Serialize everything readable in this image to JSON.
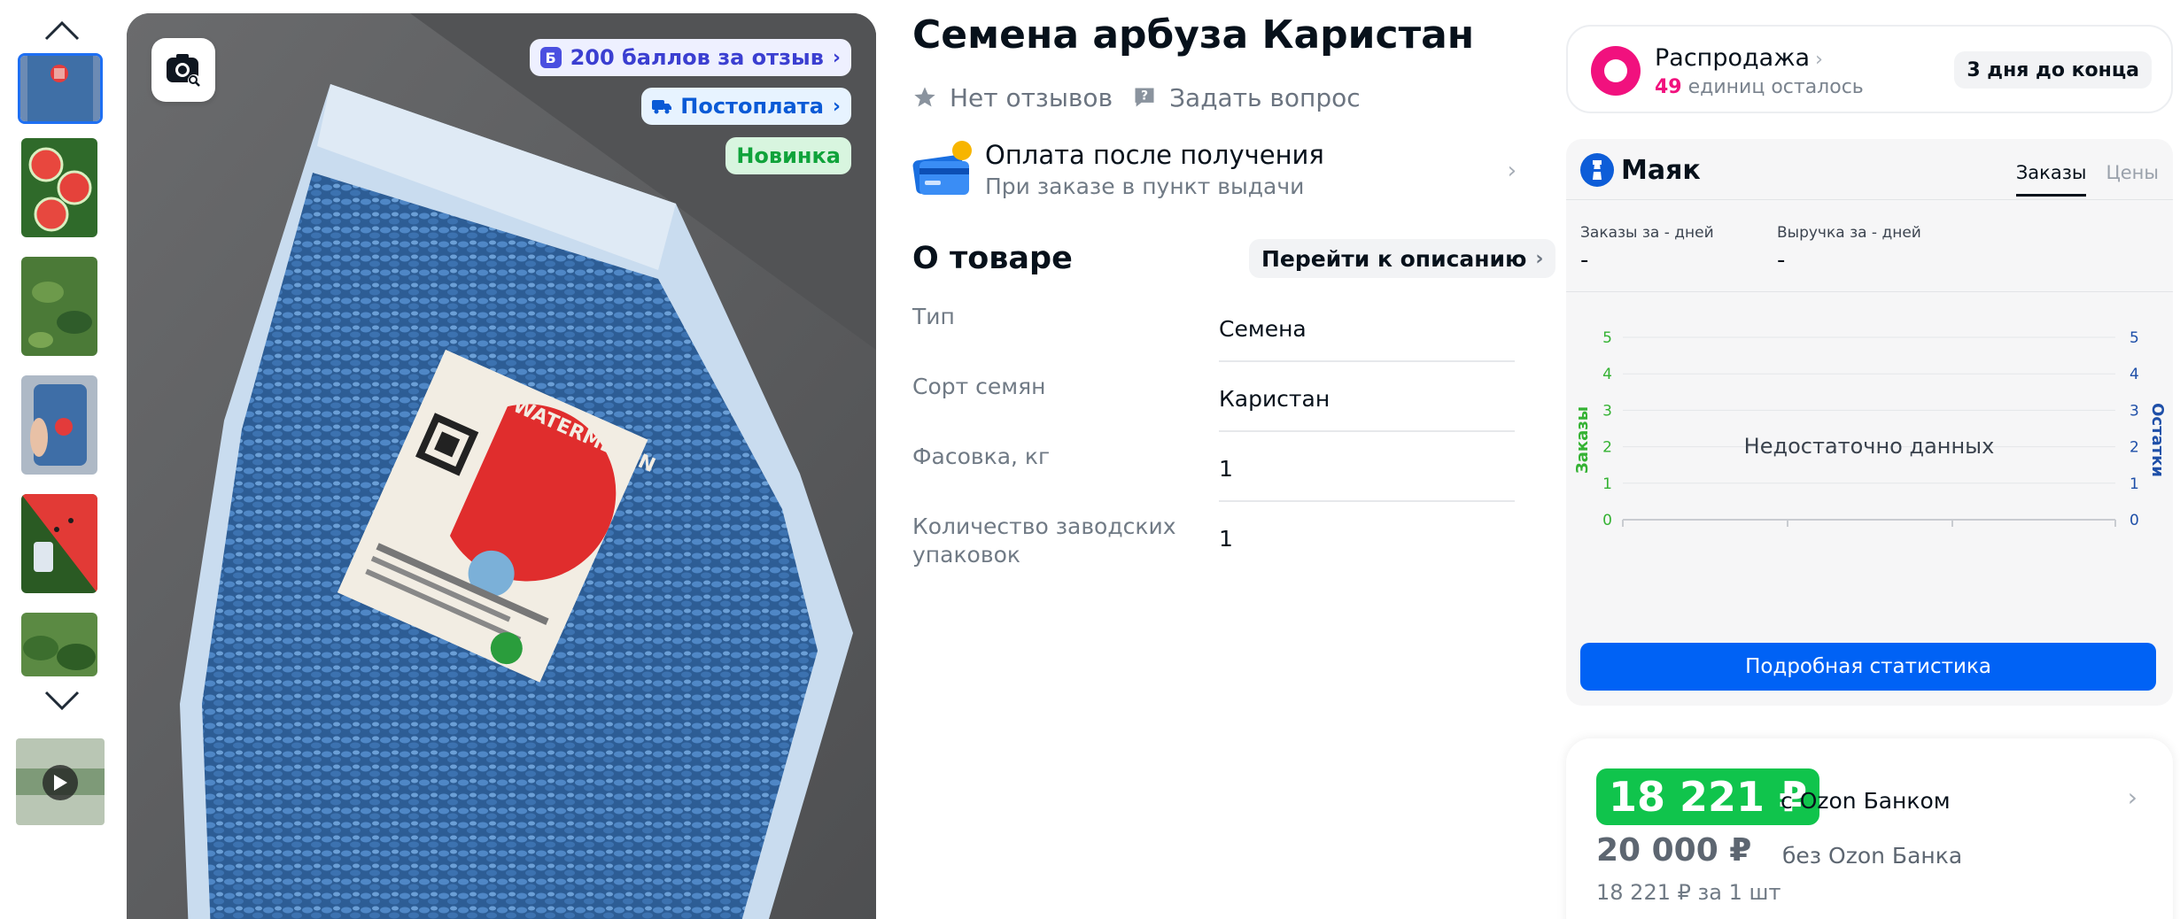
{
  "gallery": {
    "thumbnails": [
      "thumb-1",
      "thumb-2",
      "thumb-3",
      "thumb-4",
      "thumb-5",
      "thumb-6"
    ],
    "video_thumbnail": "video-thumb"
  },
  "main_image": {
    "badges": {
      "points": "200 баллов за отзыв",
      "points_icon": "Б",
      "postpay": "Постоплата",
      "new": "Новинка"
    },
    "package_label_text": "WATERMELON"
  },
  "product": {
    "title": "Семена арбуза Каристан",
    "reviews": "Нет отзывов",
    "ask_question": "Задать вопрос",
    "payment": {
      "title": "Оплата после получения",
      "subtitle": "При заказе в пункт выдачи"
    },
    "about": {
      "title": "О товаре",
      "goto_description": "Перейти к описанию"
    },
    "specs": [
      {
        "key": "Тип",
        "value": "Семена"
      },
      {
        "key": "Сорт семян",
        "value": "Каристан"
      },
      {
        "key": "Фасовка, кг",
        "value": "1"
      },
      {
        "key": "Количество заводских упаковок",
        "value": "1"
      }
    ]
  },
  "sale": {
    "title": "Распродажа",
    "count": "49",
    "remaining": "единиц осталось",
    "timer": "3 дня до конца"
  },
  "mayak": {
    "name": "Маяк",
    "tabs": [
      "Заказы",
      "Цены"
    ],
    "active_tab": "Заказы",
    "stats": [
      {
        "label": "Заказы за - дней",
        "value": "-"
      },
      {
        "label": "Выручка за - дней",
        "value": "-"
      }
    ],
    "chart_message": "Недостаточно данных",
    "left_axis_label": "Заказы",
    "right_axis_label": "Остатки",
    "ticks": [
      "0",
      "1",
      "2",
      "3",
      "4",
      "5"
    ],
    "button": "Подробная статистика",
    "colors": {
      "left_axis": "#34b233",
      "right_axis": "#1e4fa8",
      "button": "#0062f5"
    }
  },
  "price": {
    "with_card": "18 221 ₽",
    "with_card_label": "с Ozon Банком",
    "without_card": "20 000 ₽",
    "without_card_label": "без Ozon Банка",
    "per_unit": "18 221 ₽ за 1 шт"
  }
}
